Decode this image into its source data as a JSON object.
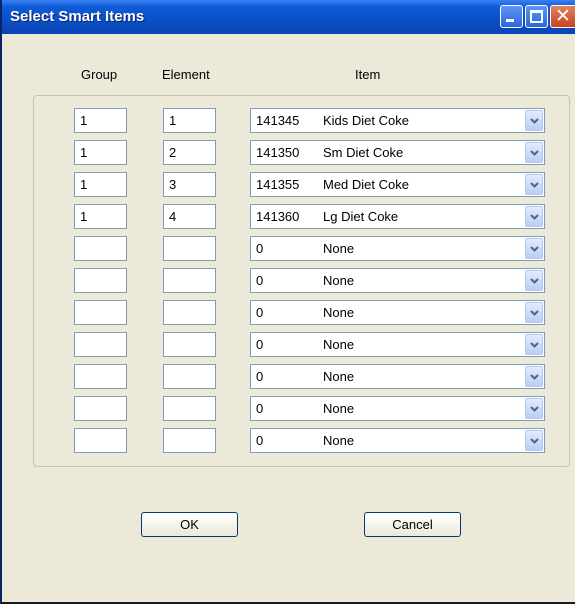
{
  "window": {
    "title": "Select Smart Items"
  },
  "headers": {
    "group": "Group",
    "element": "Element",
    "item": "Item"
  },
  "rows": [
    {
      "group": "1",
      "element": "1",
      "code": "141345",
      "name": "Kids Diet Coke"
    },
    {
      "group": "1",
      "element": "2",
      "code": "141350",
      "name": "Sm Diet Coke"
    },
    {
      "group": "1",
      "element": "3",
      "code": "141355",
      "name": "Med Diet Coke"
    },
    {
      "group": "1",
      "element": "4",
      "code": "141360",
      "name": "Lg Diet Coke"
    },
    {
      "group": "",
      "element": "",
      "code": "0",
      "name": "None"
    },
    {
      "group": "",
      "element": "",
      "code": "0",
      "name": "None"
    },
    {
      "group": "",
      "element": "",
      "code": "0",
      "name": "None"
    },
    {
      "group": "",
      "element": "",
      "code": "0",
      "name": "None"
    },
    {
      "group": "",
      "element": "",
      "code": "0",
      "name": "None"
    },
    {
      "group": "",
      "element": "",
      "code": "0",
      "name": "None"
    },
    {
      "group": "",
      "element": "",
      "code": "0",
      "name": "None"
    }
  ],
  "buttons": {
    "ok": "OK",
    "cancel": "Cancel"
  }
}
